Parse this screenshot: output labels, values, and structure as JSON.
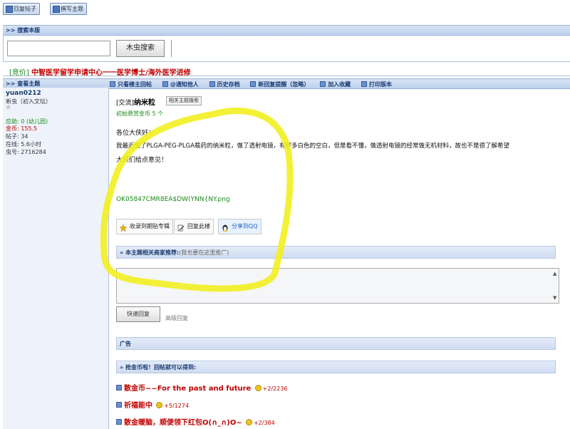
{
  "toolbar": {
    "reply_post": "回复帖子",
    "new_topic": "撰写主题"
  },
  "search": {
    "section_title": ">> 搜索本版",
    "input_value": "",
    "button": "木虫搜索"
  },
  "sponsor": {
    "tag": "[竞价]",
    "link": "中智医学留学申请中心一一医学博士/海外医学进修"
  },
  "topic_bar": {
    "left": ">> 查看主题",
    "actions": [
      "只看楼主回帖",
      "@通知他人",
      "历史存档",
      "新回复提醒（忽略）",
      "加入收藏",
      "打印版本"
    ]
  },
  "author": {
    "name": "yuan0212",
    "rank": "新虫（初入文坛）",
    "stars": "☆",
    "help": "应助: 0 (幼儿园)",
    "coins": "金币: 155.5",
    "posts": "帖子: 34",
    "online": "在线: 5.6小时",
    "id": "虫号: 2716284"
  },
  "post": {
    "title_tag": "[交流]",
    "title": "纳米粒",
    "related_btn": "相关主题搜索",
    "bounty": "初始悬赏金币 5 个",
    "greeting": "各位大侠好：",
    "line1": "我最近做了PLGA-PEG-PLGA载药的纳米粒，做了透射电镜，有好多白色的空白，但是看不懂，做透射电镜的经常做无机材料，故也不是很了解希望",
    "line2": "大侠们给点意见！",
    "attachment": "OK05847CMR8EA$DW(YNN{NY.png",
    "buttons": {
      "collect": "收录到期贴专辑",
      "reply": "回复此楼",
      "share": "分享到QQ"
    }
  },
  "recommend": {
    "label": "» 本主题相关商家推荐:",
    "note": "(我也要在这里推广)"
  },
  "quick_reply": {
    "button": "快速回复",
    "advanced": "高级回复"
  },
  "ad": {
    "label": "广告"
  },
  "coin_section": {
    "label": "» 抢金币啦！回帖就可以得到:"
  },
  "hot_posts": [
    {
      "title": "散金币~~For the past and future",
      "bonus": "+2",
      "count": "/2236"
    },
    {
      "title": "祈福能中",
      "bonus": "+5",
      "count": "/1274"
    },
    {
      "title": "散金暖脑，顺便领下红包O(∩_∩)O~",
      "bonus": "+2",
      "count": "/384"
    }
  ],
  "colors": {
    "bar": "#c6d6ef",
    "accent_red": "#c00000",
    "green": "#1a8a1a",
    "highlight": "#f5f020"
  }
}
